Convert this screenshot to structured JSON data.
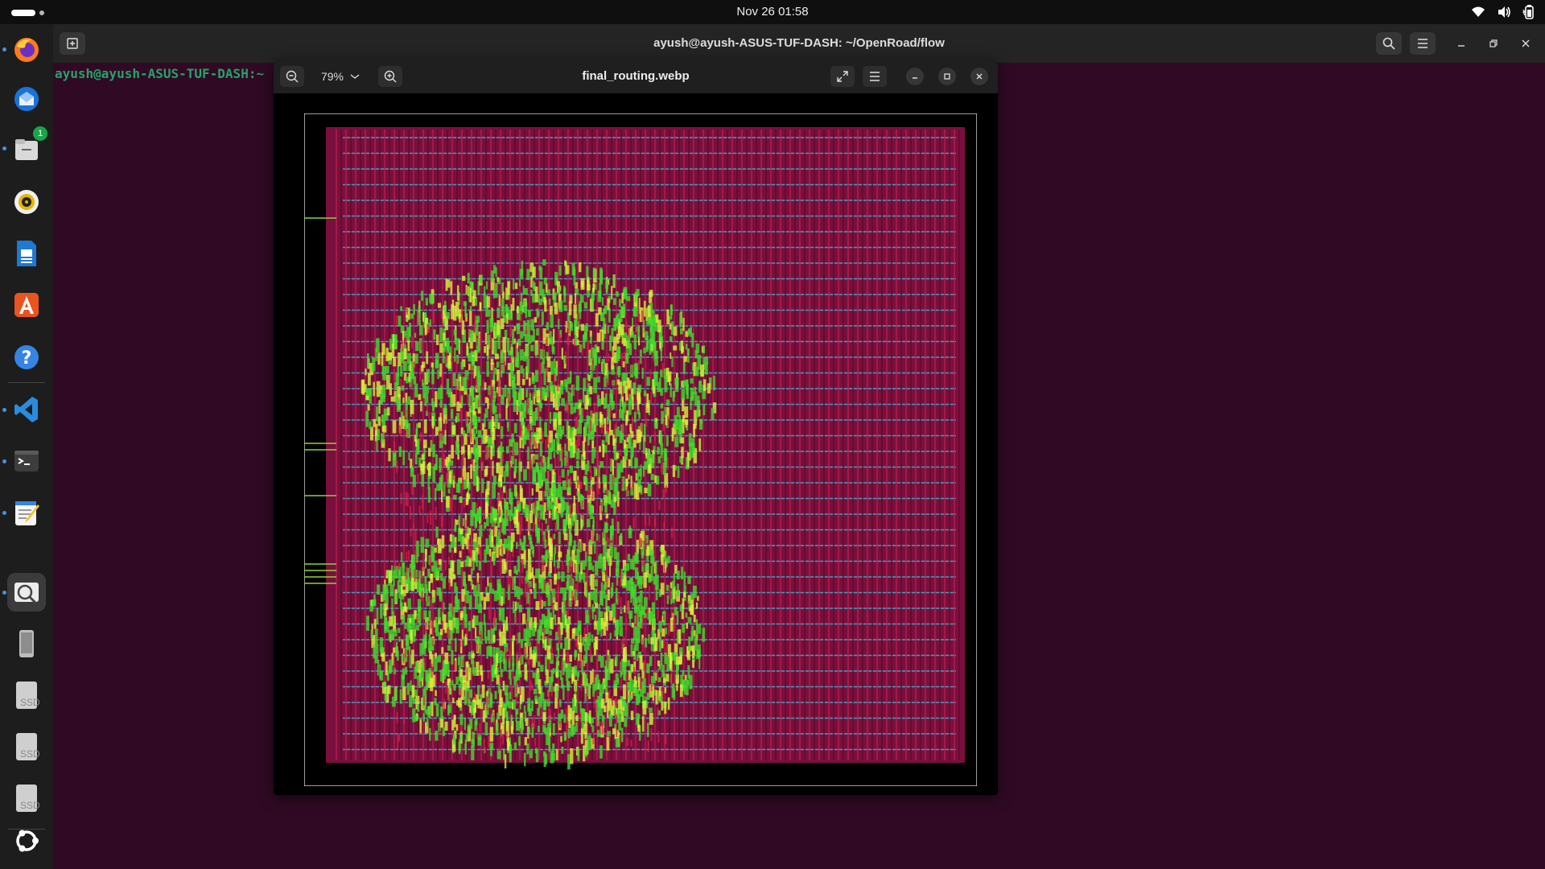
{
  "topbar": {
    "clock": "Nov 26  01:58",
    "icons": [
      "wifi-icon",
      "volume-icon",
      "battery-icon"
    ]
  },
  "dock": {
    "items": [
      {
        "name": "firefox",
        "running": true
      },
      {
        "name": "thunderbird",
        "running": false
      },
      {
        "name": "files",
        "running": true,
        "badge": "1"
      },
      {
        "name": "rhythmbox",
        "running": false
      },
      {
        "name": "libreoffice-writer",
        "running": false
      },
      {
        "name": "app-center",
        "running": false
      },
      {
        "name": "help",
        "running": false
      },
      {
        "name": "vscode",
        "running": true
      },
      {
        "name": "terminal",
        "running": true
      },
      {
        "name": "text-editor",
        "running": true
      },
      {
        "name": "image-viewer",
        "running": true,
        "active": true
      },
      {
        "name": "removable-drive",
        "running": false
      },
      {
        "name": "ssd-1",
        "label": "SSD"
      },
      {
        "name": "ssd-2",
        "label": "SSD"
      },
      {
        "name": "ssd-3",
        "label": "SSD"
      },
      {
        "name": "show-apps",
        "running": false
      }
    ]
  },
  "terminal": {
    "title": "ayush@ayush-ASUS-TUF-DASH: ~/OpenRoad/flow",
    "prompt": "ayush@ayush-ASUS-TUF-DASH:~"
  },
  "viewer": {
    "filename": "final_routing.webp",
    "zoom": "79%"
  },
  "colors": {
    "terminal_bg": "#300a24",
    "prompt": "#26a269",
    "die_fill": "#7a0f3c",
    "metal_h": "#39b6d6",
    "stdcell": "#3ddc2a"
  }
}
